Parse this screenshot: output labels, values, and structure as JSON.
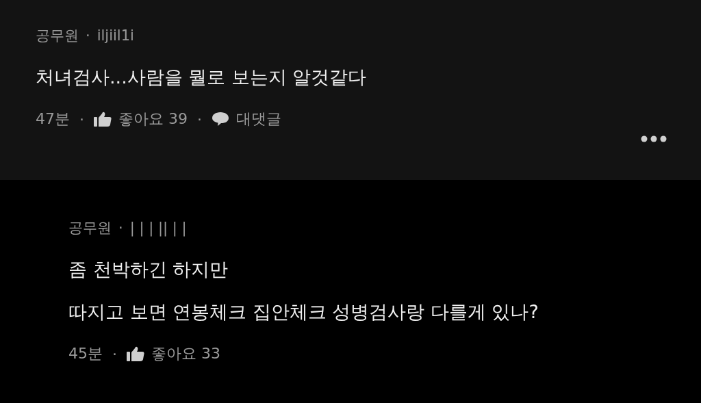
{
  "comments": [
    {
      "kind": "comment",
      "author": "공무원",
      "separator": "·",
      "user": "iljiil1i",
      "lines": [
        "처녀검사...사람을 뭘로 보는지 알것같다"
      ],
      "time": "47분",
      "likes_label": "좋아요 39",
      "reply_label": "대댓글",
      "menu": true
    },
    {
      "kind": "reply",
      "author": "공무원",
      "separator": "·",
      "user": "| | | || |  |",
      "lines": [
        "좀 천박하긴 하지만",
        "따지고 보면 연봉체크 집안체크 성병검사랑 다를게 있나?"
      ],
      "time": "45분",
      "likes_label": "좋아요 33",
      "menu": false
    }
  ]
}
